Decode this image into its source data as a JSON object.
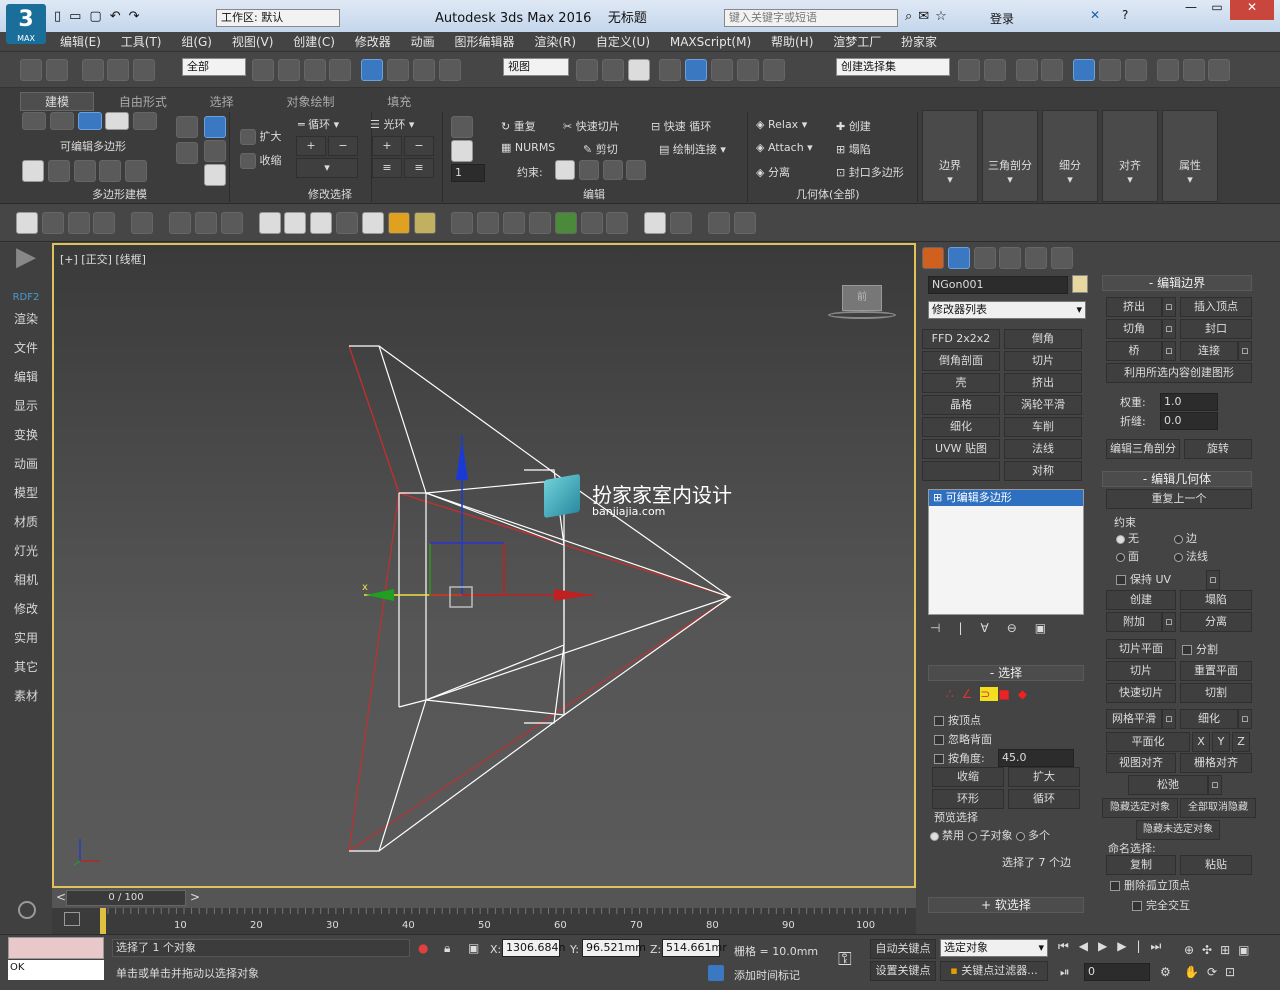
{
  "titlebar": {
    "app_icon": "MAX",
    "workspace": "工作区: 默认",
    "title": "Autodesk 3ds Max 2016",
    "doc": "无标题",
    "search_placeholder": "键入关键字或短语",
    "login": "登录"
  },
  "menu": [
    "编辑(E)",
    "工具(T)",
    "组(G)",
    "视图(V)",
    "创建(C)",
    "修改器",
    "动画",
    "图形编辑器",
    "渲染(R)",
    "自定义(U)",
    "MAXScript(M)",
    "帮助(H)",
    "渲梦工厂",
    "扮家家"
  ],
  "toolbar": {
    "filter": "全部",
    "refcoord": "视图",
    "selset": "创建选择集"
  },
  "ribbon": {
    "tabs": [
      "建模",
      "自由形式",
      "选择",
      "对象绘制",
      "填充"
    ],
    "poly_label": "可编辑多边形",
    "poly_group": "多边形建模",
    "modsel": {
      "grow": "扩大",
      "shrink": "收缩",
      "loop": "循环",
      "ring": "光环",
      "group": "修改选择"
    },
    "edit": {
      "repeat": "重复",
      "quickslice": "快速切片",
      "swiftloop": "快速 循环",
      "nurms": "NURMS",
      "cut": "剪切",
      "paintconnect": "绘制连接",
      "constraint": "约束:",
      "group": "编辑",
      "spin": "1"
    },
    "geom": {
      "relax": "Relax",
      "create": "创建",
      "attach": "Attach",
      "collapse": "塌陷",
      "detach": "分离",
      "cap": "封口多边形",
      "group": "几何体(全部)"
    },
    "big": [
      "边界",
      "三角剖分",
      "细分",
      "对齐",
      "属性"
    ]
  },
  "left_panel": [
    "RDF2",
    "渲染",
    "文件",
    "编辑",
    "显示",
    "变换",
    "动画",
    "模型",
    "材质",
    "灯光",
    "相机",
    "修改",
    "实用",
    "其它",
    "素材"
  ],
  "viewport": {
    "label": "[+] [正交] [线框]",
    "watermark": "扮家家室内设计",
    "watermark_url": "banjiajia.com",
    "cube": "前"
  },
  "cmd": {
    "object_name": "NGon001",
    "modifier_list": "修改器列表",
    "mods": [
      [
        "FFD 2x2x2",
        "倒角"
      ],
      [
        "倒角剖面",
        "切片"
      ],
      [
        "壳",
        "挤出"
      ],
      [
        "晶格",
        "涡轮平滑"
      ],
      [
        "细化",
        "车削"
      ],
      [
        "UVW 贴图",
        "法线"
      ],
      [
        "",
        "对称"
      ]
    ],
    "stack_item": "可编辑多边形",
    "sel_title": "选择",
    "by_vertex": "按顶点",
    "ignore_back": "忽略背面",
    "by_angle": "按角度:",
    "angle_val": "45.0",
    "shrink": "收缩",
    "grow": "扩大",
    "ring": "环形",
    "loop": "循环",
    "preview": "预览选择",
    "disable": "禁用",
    "subobj": "子对象",
    "multi": "多个",
    "sel_count": "选择了 7 个边",
    "soft": "软选择"
  },
  "edit_border": {
    "title": "编辑边界",
    "extrude": "挤出",
    "insert_vertex": "插入顶点",
    "chamfer": "切角",
    "cap": "封口",
    "bridge": "桥",
    "connect": "连接",
    "create_shape": "利用所选内容创建图形",
    "weight": "权重:",
    "weight_val": "1.0",
    "crease": "折缝:",
    "crease_val": "0.0",
    "edit_tri": "编辑三角剖分",
    "turn": "旋转"
  },
  "edit_geom": {
    "title": "编辑几何体",
    "repeat": "重复上一个",
    "constraint": "约束",
    "none": "无",
    "edge": "边",
    "face": "面",
    "normal": "法线",
    "preserve_uv": "保持 UV",
    "create": "创建",
    "collapse": "塌陷",
    "attach": "附加",
    "detach": "分离",
    "slice_plane": "切片平面",
    "split": "分割",
    "slice": "切片",
    "reset_plane": "重置平面",
    "quickslice": "快速切片",
    "cut": "切割",
    "meshsmooth": "网格平滑",
    "tessellate": "细化",
    "planarize": "平面化",
    "x": "X",
    "y": "Y",
    "z": "Z",
    "view_align": "视图对齐",
    "grid_align": "栅格对齐",
    "relax": "松弛",
    "hide_sel": "隐藏选定对象",
    "unhide_all": "全部取消隐藏",
    "hide_unsel": "隐藏未选定对象",
    "named_sel": "命名选择:",
    "copy": "复制",
    "paste": "粘贴",
    "delete_iso": "删除孤立顶点",
    "full_interact": "完全交互"
  },
  "timeline": {
    "frame": "0 / 100",
    "ticks": [
      "10",
      "20",
      "30",
      "40",
      "50",
      "60",
      "70",
      "80",
      "90",
      "100"
    ]
  },
  "status": {
    "ok": "OK",
    "sel": "选择了 1 个对象",
    "hint": "单击或单击并拖动以选择对象",
    "x": "1306.684n",
    "y": "96.521mm",
    "z": "514.661mr",
    "grid": "栅格 = 10.0mm",
    "autokey": "自动关键点",
    "setkey": "设置关键点",
    "selobj": "选定对象",
    "keyfilter": "关键点过滤器...",
    "addtime": "添加时间标记",
    "frame_field": "0"
  }
}
